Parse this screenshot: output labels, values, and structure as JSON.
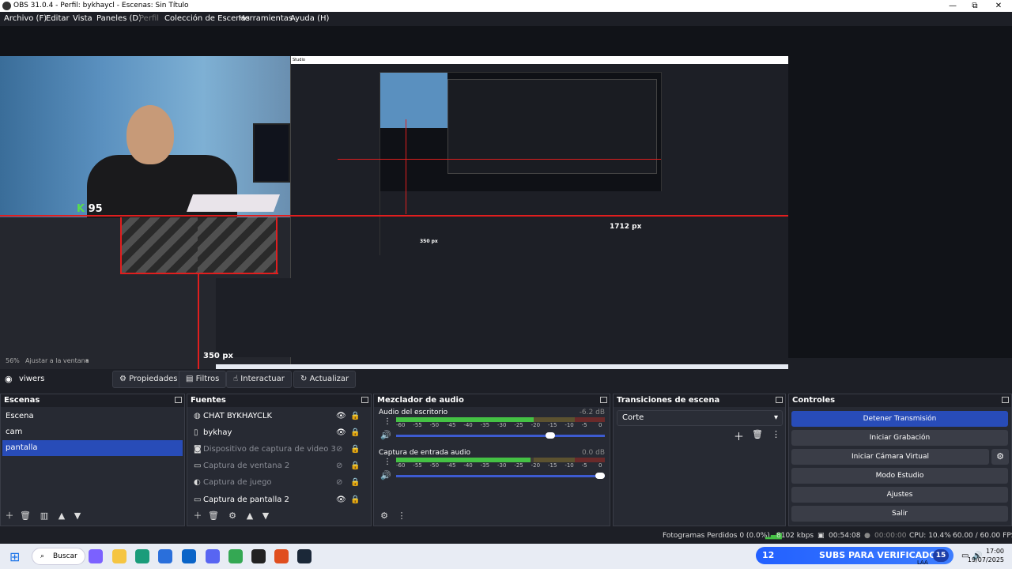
{
  "window": {
    "title": "OBS 31.0.4 - Perfil: bykhaycl - Escenas: Sin Título",
    "minimize": "—",
    "maximize": "⧉",
    "close": "✕"
  },
  "menu": {
    "archivo": "Archivo (F)",
    "editar": "Editar",
    "vista": "Vista",
    "paneles": "Paneles (D)",
    "perfil": "Perfil",
    "coleccion": "Colección de Escenas",
    "herramientas": "Herramientas",
    "ayuda": "Ayuda (H)"
  },
  "preview": {
    "px_350": "350 px",
    "px_1712": "1712 px",
    "kill_count": "95",
    "nested_title": "Studio",
    "nested_px350": "350 px"
  },
  "zoom": {
    "level": "56%",
    "mode": "Ajustar a la ventana"
  },
  "source_toolbar": {
    "scene": "viwers",
    "propiedades": "Propiedades",
    "filtros": "Filtros",
    "interactuar": "Interactuar",
    "actualizar": "Actualizar"
  },
  "escenas": {
    "title": "Escenas",
    "items": [
      "Escena",
      "cam",
      "pantalla"
    ]
  },
  "fuentes": {
    "title": "Fuentes",
    "items": [
      {
        "label": "CHAT BYKHAYCLK",
        "icon": "browser-icon"
      },
      {
        "label": "bykhay",
        "icon": "text-icon"
      },
      {
        "label": "Dispositivo de captura de video 3",
        "icon": "camera-icon"
      },
      {
        "label": "Captura de ventana 2",
        "icon": "window-icon"
      },
      {
        "label": "Captura de juego",
        "icon": "gamepad-icon"
      },
      {
        "label": "Captura de pantalla 2",
        "icon": "monitor-icon"
      }
    ]
  },
  "mixer": {
    "title": "Mezclador de audio",
    "tracks": [
      {
        "name": "Audio del escritorio",
        "db": "-6.2 dB",
        "volume": 0.75
      },
      {
        "name": "Captura de entrada audio",
        "db": "0.0 dB",
        "volume": 1.0
      }
    ],
    "scale": [
      "-60",
      "-55",
      "-50",
      "-45",
      "-40",
      "-35",
      "-30",
      "-25",
      "-20",
      "-15",
      "-10",
      "-5",
      "0"
    ]
  },
  "transitions": {
    "title": "Transiciones de escena",
    "selected": "Corte"
  },
  "controls": {
    "title": "Controles",
    "buttons": [
      "Detener Transmisión",
      "Iniciar Grabación",
      "Iniciar Cámara Virtual",
      "Modo Estudio",
      "Ajustes",
      "Salir"
    ]
  },
  "status": {
    "dropped": "Fotogramas Perdidos 0 (0.0%)",
    "bitrate": "8102 kbps",
    "stream_time": "00:54:08",
    "rec_time": "00:00:00",
    "cpu": "CPU: 10.4%",
    "fps": "60.00 / 60.00 FPS"
  },
  "taskbar": {
    "search": "Buscar",
    "subs_left": "12",
    "subs_text": "SUBS PARA VERIFICADO",
    "subs_right": "15",
    "time": "17:00",
    "date": "19/07/2025",
    "lang": "LAA"
  },
  "colors": {
    "accent": "#284cb8",
    "background": "#1d1f26",
    "dock": "#272a33",
    "meter_green": "#44c144",
    "red_guide": "#e01e1e"
  }
}
